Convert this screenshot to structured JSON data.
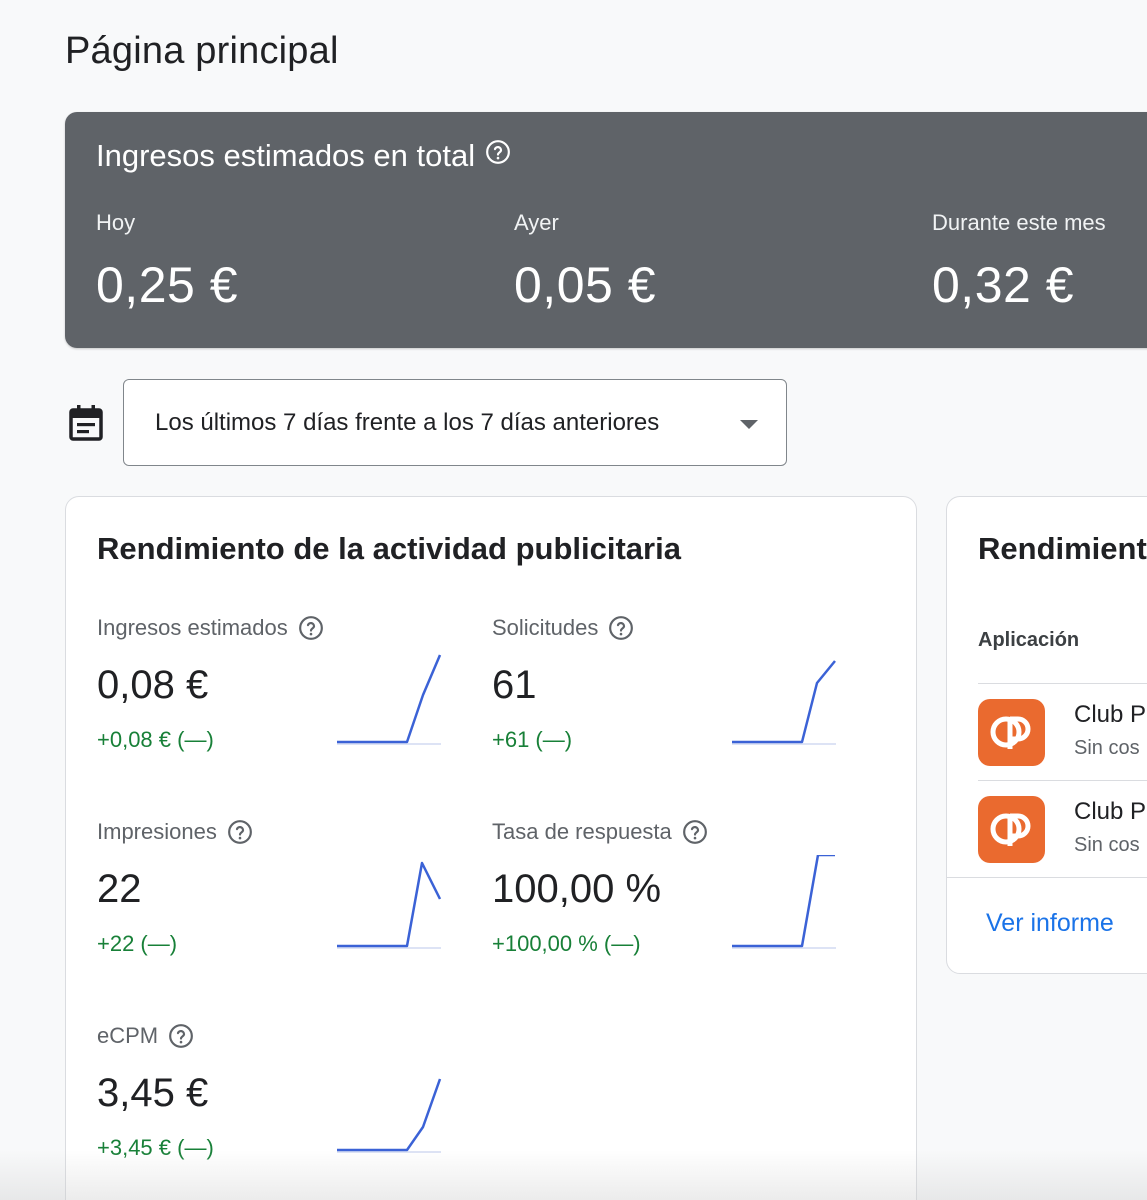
{
  "page": {
    "title": "Página principal"
  },
  "earnings": {
    "title": "Ingresos estimados en total",
    "columns": [
      {
        "label": "Hoy",
        "value": "0,25 €"
      },
      {
        "label": "Ayer",
        "value": "0,05 €"
      },
      {
        "label": "Durante este mes",
        "value": "0,32 €"
      }
    ]
  },
  "date_range": {
    "label": "Los últimos 7 días frente a los 7 días anteriores"
  },
  "performance": {
    "title": "Rendimiento de la actividad publicitaria",
    "metrics": [
      {
        "label": "Ingresos estimados",
        "value": "0,08 €",
        "delta": "+0,08 € (—)"
      },
      {
        "label": "Solicitudes",
        "value": "61",
        "delta": "+61 (—)"
      },
      {
        "label": "Impresiones",
        "value": "22",
        "delta": "+22 (—)"
      },
      {
        "label": "Tasa de respuesta",
        "value": "100,00 %",
        "delta": "+100,00 % (—)"
      },
      {
        "label": "eCPM",
        "value": "3,45 €",
        "delta": "+3,45 € (—)"
      }
    ]
  },
  "apps_card": {
    "title": "Rendimiento",
    "column_header": "Aplicación",
    "apps": [
      {
        "name": "Club P",
        "subtitle": "Sin cos"
      },
      {
        "name": "Club P",
        "subtitle": "Sin cos"
      }
    ],
    "link": "Ver informe"
  },
  "colors": {
    "banner_bg": "#5f6368",
    "positive": "#188038",
    "link": "#1a73e8",
    "sparkline": "#3b62d6",
    "app_icon": "#ea6a2f"
  },
  "icons": [
    "help-icon",
    "calendar-icon",
    "dropdown-caret-icon",
    "app-logo-icon"
  ]
}
